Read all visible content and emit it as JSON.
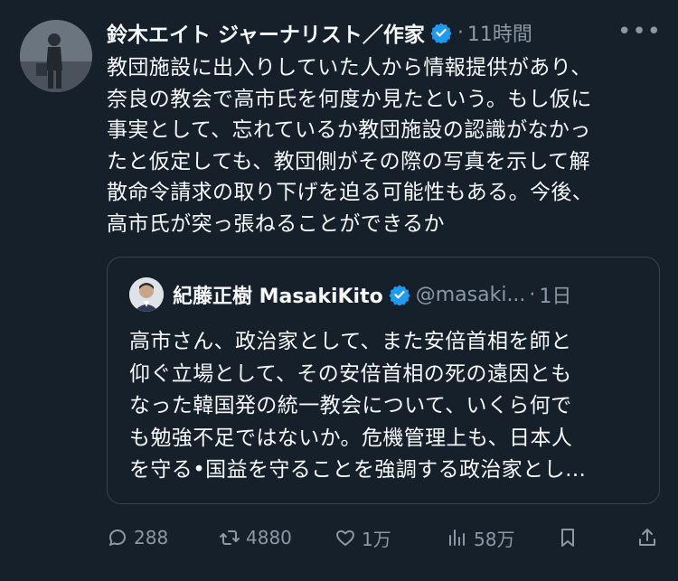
{
  "tweet": {
    "author_name": "鈴木エイト ジャーナリスト／作家",
    "time": "11時間",
    "more_icon": "more-horizontal-icon",
    "text": "教団施設に出入りしていた人から情報提供があり、\n奈良の教会で高市氏を何度か見たという。もし仮に\n事実として、忘れているか教団施設の認識がなかっ\nたと仮定しても、教団側がその際の写真を示して解\n散命令請求の取り下げを迫る可能性もある。今後、\n高市氏が突っ張ねることができるか"
  },
  "quote": {
    "author_name": "紀藤正樹 MasakiKito",
    "handle": "@masaki...",
    "time": "1日",
    "text": "高市さん、政治家として、また安倍首相を師と\n仰ぐ立場として、その安倍首相の死の遠因とも\nなった韓国発の統一教会について、いくら何で\nも勉強不足ではないか。危機管理上も、日本人\nを守る•国益を守ることを強調する政治家とし…"
  },
  "actions": {
    "reply": {
      "icon": "reply-icon",
      "count": "288"
    },
    "retweet": {
      "icon": "retweet-icon",
      "count": "4880"
    },
    "like": {
      "icon": "heart-icon",
      "count": "1万"
    },
    "views": {
      "icon": "analytics-icon",
      "count": "58万"
    },
    "bookmark": {
      "icon": "bookmark-icon"
    },
    "share": {
      "icon": "share-icon"
    }
  },
  "colors": {
    "background": "#15202b",
    "text": "#f7f9f9",
    "secondary": "#8b98a5",
    "border": "#38444d",
    "verified": "#1d9bf0"
  }
}
